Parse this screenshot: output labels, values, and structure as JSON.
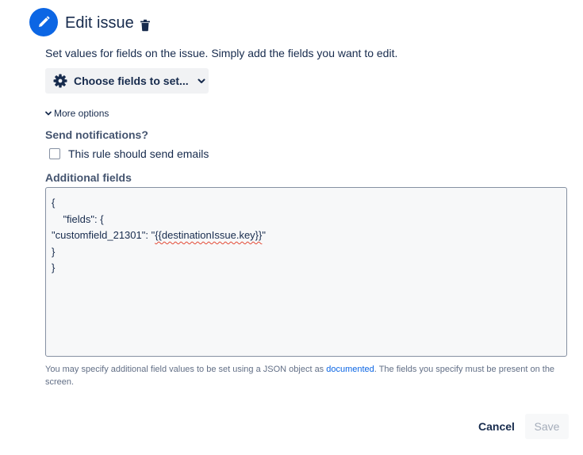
{
  "header": {
    "title": "Edit issue",
    "icon": "pencil-icon",
    "delete_icon": "trash-icon",
    "accent_color": "#0c66e4"
  },
  "description": "Set values for fields on the issue. Simply add the fields you want to edit.",
  "choose_fields": {
    "label": "Choose fields to set...",
    "icon": "gear-icon"
  },
  "more_options": {
    "label": "More options"
  },
  "notifications": {
    "label": "Send notifications?",
    "checkbox_label": "This rule should send emails",
    "checked": false
  },
  "additional_fields": {
    "label": "Additional fields",
    "lines": [
      "{",
      "    \"fields\": {",
      "\"customfield_21301\": \"{{destinationIssue.key}}\"",
      "}",
      "}"
    ],
    "line3_prefix": "\"customfield_21301\": \"",
    "line3_squiggle": "{{destinationIssue.key}}",
    "line3_suffix": "\""
  },
  "help": {
    "text_before": "You may specify additional field values to be set using a JSON object as ",
    "link": "documented",
    "text_after": ". The fields you specify must be present on the screen."
  },
  "footer": {
    "cancel_label": "Cancel",
    "save_label": "Save"
  }
}
